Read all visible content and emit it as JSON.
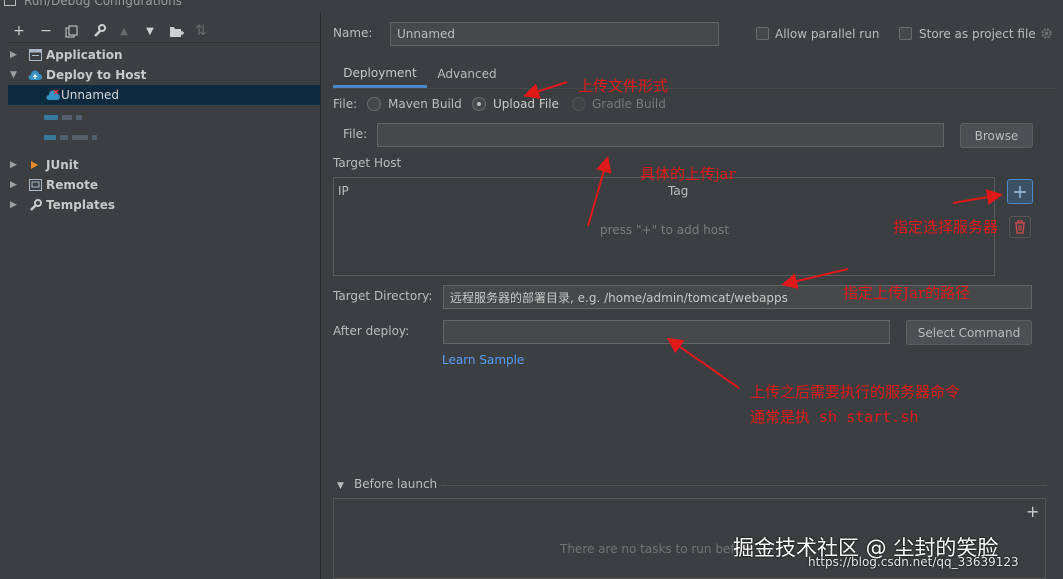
{
  "window": {
    "title": "Run/Debug Configurations"
  },
  "toolbar": {
    "add": "+",
    "remove": "−",
    "copy": "⧉",
    "edit": "🔧",
    "up": "▲",
    "down": "▼",
    "folder": "📁+",
    "sort": "⇅"
  },
  "tree": {
    "application": "Application",
    "deploy_to_host": "Deploy to Host",
    "unnamed": "Unnamed",
    "junit": "JUnit",
    "remote": "Remote",
    "templates": "Templates"
  },
  "name_label": "Name:",
  "name_value": "Unnamed",
  "allow_parallel": "Allow parallel run",
  "store_project": "Store as project file",
  "tabs": [
    "Deployment",
    "Advanced"
  ],
  "file_label": "File:",
  "radios": [
    "Maven Build",
    "Upload File",
    "Gradle Build"
  ],
  "file_field_label": "File:",
  "file_field_value": "",
  "browse": "Browse",
  "target_host": "Target Host",
  "table": {
    "col_ip": "IP",
    "col_tag": "Tag",
    "empty": "press \"+\" to add host"
  },
  "target_dir_label": "Target Directory:",
  "target_dir_placeholder": "远程服务器的部署目录, e.g. /home/admin/tomcat/webapps",
  "after_deploy_label": "After deploy:",
  "after_deploy_value": "",
  "select_command": "Select Command",
  "learn_sample": "Learn Sample",
  "before_launch": "Before launch",
  "before_launch_empty": "There are no tasks to run before",
  "before_launch_add": "+",
  "annotations": {
    "upload": "上传文件形式",
    "jar": "具体的上传jar",
    "server": "指定选择服务器",
    "path": "指定上传Jar的路径",
    "cmd1": "上传之后需要执行的服务器命令",
    "cmd2": "通常是执 sh start.sh"
  },
  "watermark": {
    "main": "掘金技术社区 @ 尘封的笑脸",
    "url": "https://blog.csdn.net/qq_33639123"
  },
  "colors": {
    "accent": "#4a88c7",
    "annotation": "#e01919",
    "selection": "#0d293e"
  }
}
